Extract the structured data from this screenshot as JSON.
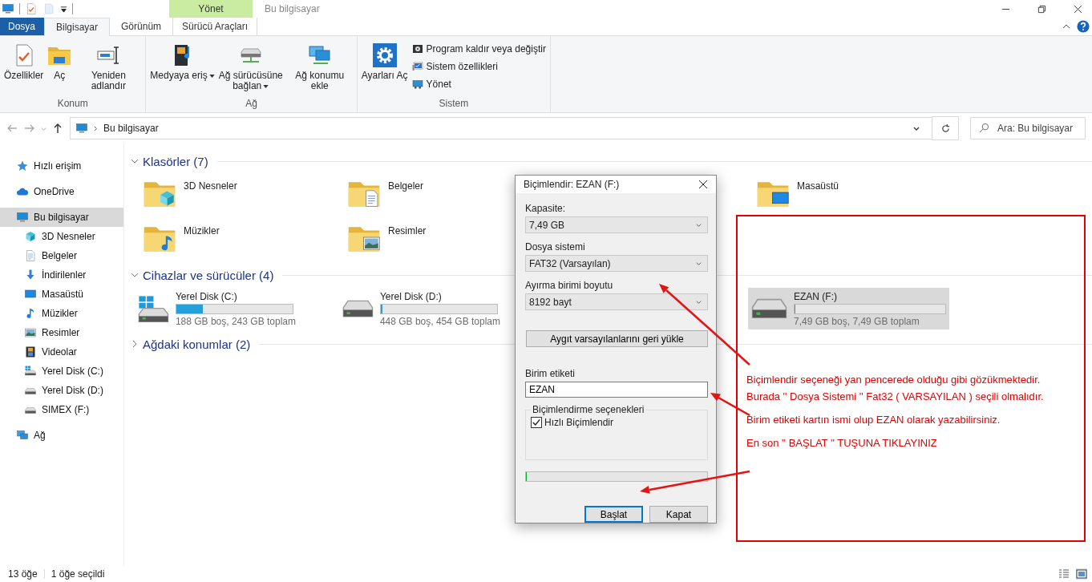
{
  "title_bar": {
    "title": "Bu bilgisayar",
    "context_header": "Yönet"
  },
  "tabs": [
    {
      "label": "Dosya",
      "kind": "file",
      "selected": false
    },
    {
      "label": "Bilgisayar",
      "kind": "tab",
      "selected": true
    },
    {
      "label": "Görünüm",
      "kind": "tab",
      "selected": false
    },
    {
      "label": "Sürücü Araçları",
      "kind": "context",
      "selected": false
    }
  ],
  "ribbon_groups": [
    {
      "label": "Konum",
      "large": [
        {
          "label": "Özellikler",
          "kind": "props",
          "dropdown": false
        },
        {
          "label": "Aç",
          "kind": "open",
          "dropdown": false
        },
        {
          "label": "Yeniden adlandır",
          "kind": "rename",
          "dropdown": false
        }
      ]
    },
    {
      "label": "Ağ",
      "large": [
        {
          "label": "Medyaya eriş",
          "kind": "media",
          "dropdown": true
        },
        {
          "label": "Ağ sürücüsüne bağlan",
          "kind": "netdrive",
          "dropdown": true
        },
        {
          "label": "Ağ konumu ekle",
          "kind": "netloc",
          "dropdown": false
        }
      ]
    },
    {
      "label": "Sistem",
      "large": [
        {
          "label": "Ayarları Aç",
          "kind": "gear",
          "dropdown": false
        }
      ],
      "small": [
        {
          "label": "Program kaldır veya değiştir",
          "kind": "program"
        },
        {
          "label": "Sistem özellikleri",
          "kind": "sysprops"
        },
        {
          "label": "Yönet",
          "kind": "manage"
        }
      ]
    }
  ],
  "address": {
    "path": "Bu bilgisayar",
    "search_placeholder": "Ara: Bu bilgisayar"
  },
  "sidebar": {
    "items": [
      {
        "label": "Hızlı erişim",
        "kind": "star",
        "selected": false
      },
      {
        "label": "OneDrive",
        "kind": "cloud",
        "selected": false
      },
      {
        "label": "Bu bilgisayar",
        "kind": "pc",
        "selected": true,
        "children": [
          {
            "label": "3D Nesneler",
            "kind": "cube",
            "selected": false
          },
          {
            "label": "Belgeler",
            "kind": "doc",
            "selected": false
          },
          {
            "label": "İndirilenler",
            "kind": "download",
            "selected": false
          },
          {
            "label": "Masaüstü",
            "kind": "desktop",
            "selected": false
          },
          {
            "label": "Müzikler",
            "kind": "music",
            "selected": false
          },
          {
            "label": "Resimler",
            "kind": "picture",
            "selected": false
          },
          {
            "label": "Videolar",
            "kind": "film",
            "selected": false
          },
          {
            "label": "Yerel Disk (C:)",
            "kind": "drivewin",
            "selected": false
          },
          {
            "label": "Yerel Disk (D:)",
            "kind": "drive",
            "selected": false
          },
          {
            "label": "SIMEX (F:)",
            "kind": "drive",
            "selected": false
          }
        ]
      },
      {
        "label": "Ağ",
        "kind": "network",
        "selected": false
      }
    ]
  },
  "sections": [
    {
      "title": "Klasörler (7)",
      "kind": "folders",
      "expanded": true,
      "items": [
        {
          "name": "3D Nesneler",
          "kind": "cube",
          "selected": false
        },
        {
          "name": "Belgeler",
          "kind": "doc",
          "selected": false
        },
        {
          "name": "Masaüstü",
          "kind": "desktop",
          "selected": false
        },
        {
          "name": "Müzikler",
          "kind": "music",
          "selected": false
        },
        {
          "name": "Resimler",
          "kind": "picture",
          "selected": false
        }
      ]
    },
    {
      "title": "Cihazlar ve sürücüler (4)",
      "kind": "drives",
      "expanded": true,
      "items": [
        {
          "name": "Yerel Disk (C:)",
          "kind": "drivewin",
          "level": 0.23,
          "info": "188 GB boş, 243 GB toplam",
          "selected": false
        },
        {
          "name": "Yerel Disk (D:)",
          "kind": "drive",
          "level": 0.013,
          "info": "448 GB boş, 454 GB toplam",
          "selected": false
        },
        {
          "name": "EZAN (F:)",
          "kind": "drive",
          "level": 0,
          "info": "7,49 GB boş, 7,49 GB toplam",
          "selected": true
        }
      ]
    },
    {
      "title": "Ağdaki konumlar (2)",
      "kind": "network",
      "expanded": false
    }
  ],
  "dialog": {
    "title": "Biçimlendir: EZAN (F:)",
    "fields": [
      {
        "kind": "select",
        "label": "Kapasite:",
        "value": "7,49 GB"
      },
      {
        "kind": "select",
        "label": "Dosya sistemi",
        "value": "FAT32 (Varsayılan)"
      },
      {
        "kind": "select",
        "label": "Ayırma birimi boyutu",
        "value": "8192 bayt"
      },
      {
        "kind": "button",
        "value": "Aygıt varsayılanlarını geri yükle"
      },
      {
        "kind": "input",
        "label": "Birim etiketi",
        "value": "EZAN"
      }
    ],
    "options": {
      "title": "Biçimlendirme seçenekleri",
      "checkboxes": [
        {
          "label": "Hızlı Biçimlendir",
          "checked": true
        }
      ]
    },
    "progress": {
      "level": 0
    },
    "buttons": [
      {
        "label": "Başlat",
        "default": true
      },
      {
        "label": "Kapat",
        "default": false
      }
    ]
  },
  "annotation": {
    "paragraphs": [
      [
        "Biçimlendir seçeneği yan pencerede olduğu gibi gözükmektedir.",
        "Burada '' Dosya Sistemi '' Fat32 ( VARSAYILAN ) seçili olmalıdır."
      ],
      [
        "Birim etiketi kartın ismi olup EZAN olarak yazabilirsiniz."
      ],
      [
        "En son '' BAŞLAT '' TUŞUNA TIKLAYINIZ"
      ]
    ]
  },
  "status_bar": {
    "count": "13 öğe",
    "selection": "1 öğe seçildi"
  }
}
